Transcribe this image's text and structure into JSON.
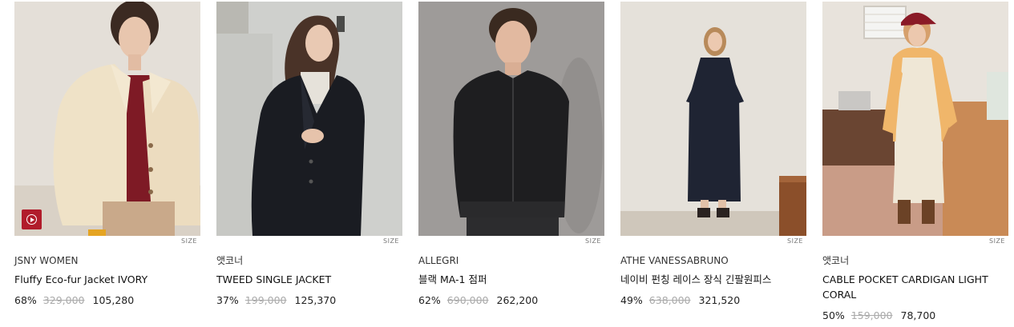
{
  "products": [
    {
      "brand": "JSNY WOMEN",
      "name": "Fluffy Eco-fur Jacket IVORY",
      "discount": "68%",
      "original_price": "329,000",
      "sale_price": "105,280",
      "size_label": "SIZE",
      "has_video": true,
      "image": "model-in-ivory-fur-jacket"
    },
    {
      "brand": "앳코너",
      "name": "TWEED SINGLE JACKET",
      "discount": "37%",
      "original_price": "199,000",
      "sale_price": "125,370",
      "size_label": "SIZE",
      "has_video": false,
      "image": "model-in-black-tweed-jacket"
    },
    {
      "brand": "ALLEGRI",
      "name": "블랙 MA-1 점퍼",
      "discount": "62%",
      "original_price": "690,000",
      "sale_price": "262,200",
      "size_label": "SIZE",
      "has_video": false,
      "image": "model-in-black-ma1-jumper"
    },
    {
      "brand": "ATHE VANESSABRUNO",
      "name": "네이비 펀칭 레이스 장식 긴팔원피스",
      "discount": "49%",
      "original_price": "638,000",
      "sale_price": "321,520",
      "size_label": "SIZE",
      "has_video": false,
      "image": "model-in-navy-long-dress"
    },
    {
      "brand": "앳코너",
      "name": "CABLE POCKET CARDIGAN LIGHT CORAL",
      "discount": "50%",
      "original_price": "159,000",
      "sale_price": "78,700",
      "size_label": "SIZE",
      "has_video": false,
      "image": "model-in-coral-cardigan-red-cap"
    }
  ],
  "colors": {
    "video_badge": "#b11c2b",
    "original_price": "#aaaaaa"
  }
}
